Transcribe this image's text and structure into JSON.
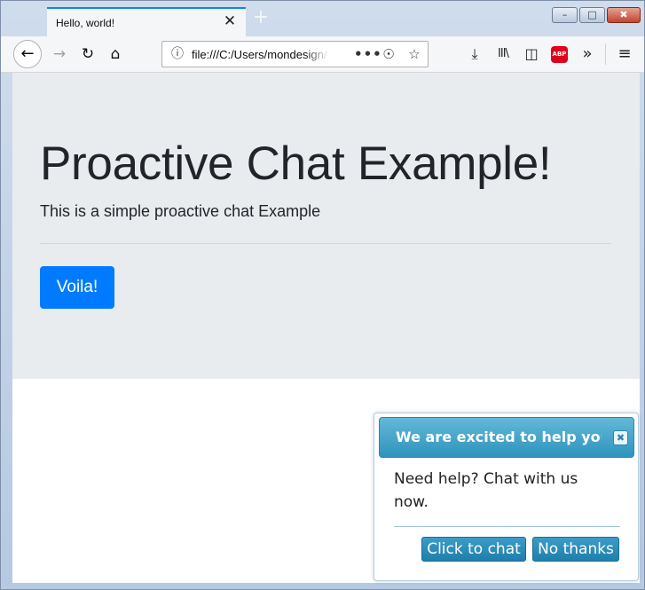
{
  "browser": {
    "tab_title": "Hello, world!",
    "tab_close_icon": "✕",
    "new_tab_icon": "+",
    "url": "file:///C:/Users/mondesign/Desktop/index.html",
    "window_controls": {
      "minimize": "–",
      "maximize": "□",
      "close": "✖"
    },
    "nav_icons": {
      "back": "←",
      "forward": "→",
      "reload": "↻",
      "home": "⌂",
      "info": "ⓘ",
      "more": "•••",
      "pocket": "☉",
      "bookmark": "☆",
      "downloads": "⤓",
      "library": "III\\",
      "sidebar": "◫",
      "adblock": "ABP",
      "overflow": "»",
      "menu": "≡"
    }
  },
  "page": {
    "title": "Proactive Chat Example!",
    "lead": "This is a simple proactive chat Example",
    "button_label": "Voila!"
  },
  "chat_popup": {
    "title": "We are excited to help you!",
    "close_icon": "✖",
    "message": "Need help? Chat with us now.",
    "accept_label": "Click to chat",
    "decline_label": "No thanks"
  }
}
